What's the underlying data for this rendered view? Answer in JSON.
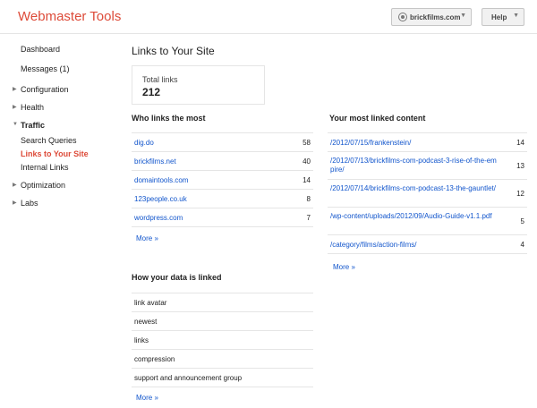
{
  "header": {
    "app_title": "Webmaster Tools",
    "site": "brickfilms.com",
    "help_label": "Help"
  },
  "sidebar": {
    "dashboard": "Dashboard",
    "messages": "Messages (1)",
    "configuration": "Configuration",
    "health": "Health",
    "traffic": "Traffic",
    "search_queries": "Search Queries",
    "links_to_your_site": "Links to Your Site",
    "internal_links": "Internal Links",
    "optimization": "Optimization",
    "labs": "Labs"
  },
  "main": {
    "title": "Links to Your Site",
    "total_links_label": "Total links",
    "total_links_value": "212",
    "who_links": {
      "title": "Who links the most",
      "rows": [
        {
          "domain": "dig.do",
          "count": "58"
        },
        {
          "domain": "brickfilms.net",
          "count": "40"
        },
        {
          "domain": "domaintools.com",
          "count": "14"
        },
        {
          "domain": "123people.co.uk",
          "count": "8"
        },
        {
          "domain": "wordpress.com",
          "count": "7"
        }
      ],
      "more": "More »"
    },
    "how_linked": {
      "title": "How your data is linked",
      "rows": [
        "link avatar",
        "newest",
        "links",
        "compression",
        "support and announcement group"
      ],
      "more": "More »"
    },
    "most_linked": {
      "title": "Your most linked content",
      "rows": [
        {
          "url": "/2012/07/15/frankenstein/",
          "count": "14"
        },
        {
          "url": "/2012/07/13/brickfilms-com-podcast-3-rise-of-the-empire/",
          "count": "13"
        },
        {
          "url": "/2012/07/14/brickfilms-com-podcast-13-the-gauntlet/",
          "count": "12"
        },
        {
          "url": "/wp-content/uploads/2012/09/Audio-Guide-v1.1.pdf",
          "count": "5"
        },
        {
          "url": "/category/films/action-films/",
          "count": "4"
        }
      ],
      "more": "More »"
    }
  }
}
